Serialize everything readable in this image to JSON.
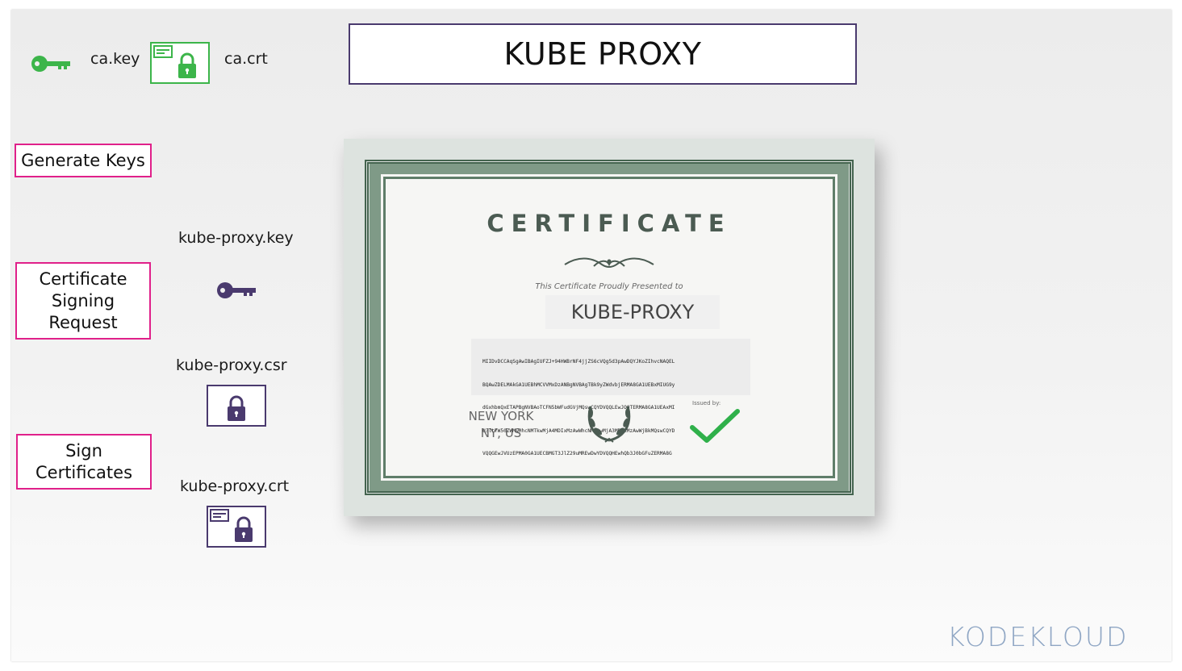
{
  "title": "KUBE PROXY",
  "ca": {
    "key_label": "ca.key",
    "crt_label": "ca.crt"
  },
  "steps": {
    "generate_keys": "Generate Keys",
    "csr": [
      "Certificate",
      "Signing",
      "Request"
    ],
    "sign": [
      "Sign",
      "Certificates"
    ]
  },
  "files": {
    "key_label": "kube-proxy.key",
    "csr_label": "kube-proxy.csr",
    "crt_label": "kube-proxy.crt"
  },
  "certificate": {
    "heading": "CERTIFICATE",
    "presented_to": "This Certificate Proudly Presented to",
    "name": "KUBE-PROXY",
    "code_lines": [
      "MIIDvDCCAqSgAwIBAgIUFZJ+94HWBrNF4jjZS6cVQg5d3pAwDQYJKoZIhvcNAQEL",
      "BQAwZDELMAkGA1UEBhMCVVMxDzANBgNVBAgTBk9yZWdvbjERMA8GA1UEBxMIUG9y",
      "dGxhbmQxETAPBgNVBAoTCFN5bWFudGVjMQswCQYDVQQLEwJOQTERMA8GA1UEAxMI",
      "U3ltYW50ZWMwHhcNMTkwMjA4MDIxMzAwWhcNMjQwMjA3MDIxMzAwWjBkMQswCQYD",
      "VQQGEwJVUzEPMA0GA1UECBMGT3JlZ29uMREwDwYDVQQHEwhQb3J0bGFuZERMA8G"
    ],
    "city_line1": "NEW YORK",
    "city_line2": "NY, US",
    "issued_by": "Issued by:"
  },
  "brand": "KODEKLOUD",
  "colors": {
    "ca_green": "#3cb54a",
    "purple": "#4a3a6e",
    "step_border": "#e0208a",
    "check_green": "#2fb04a"
  }
}
